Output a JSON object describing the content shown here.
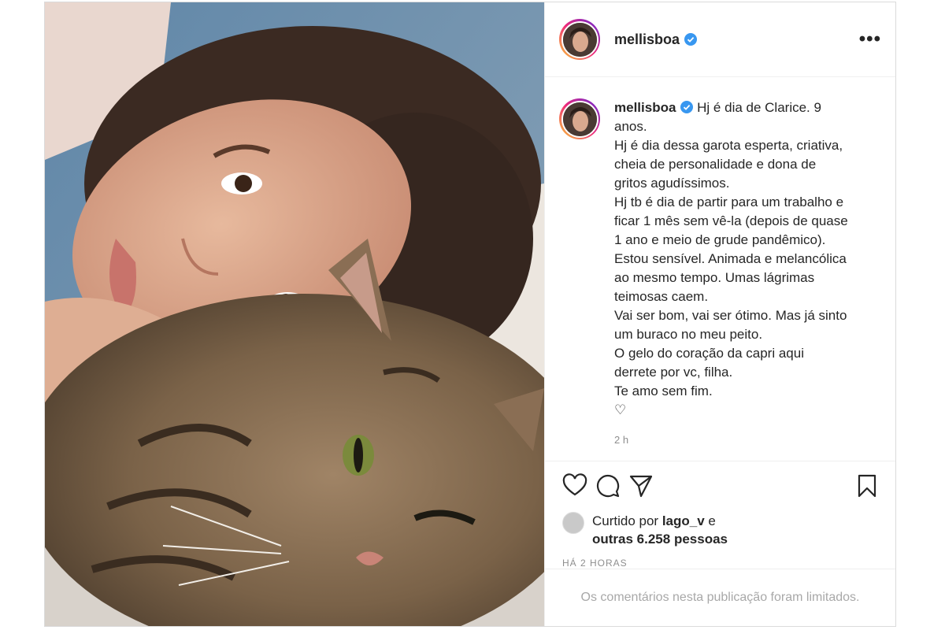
{
  "post": {
    "username": "mellisboa",
    "more_label": "•••",
    "caption": {
      "username": "mellisboa",
      "text": "Hj é dia de Clarice. 9\nanos.\nHj é dia dessa garota esperta, criativa,\ncheia de personalidade e dona de\ngritos agudíssimos.\nHj tb é dia de partir para um trabalho e\nficar 1 mês sem vê-la (depois de quase\n1 ano e meio de grude pandêmico).\nEstou sensível. Animada e melancólica\nao mesmo tempo. Umas lágrimas\nteimosas caem.\nVai ser bom, vai ser ótimo. Mas já sinto\num buraco no meu peito.\nO gelo do coração da capri aqui\nderrete por vc, filha.\nTe amo sem fim.\n♡"
    },
    "comment_time": "2 h",
    "likes": {
      "prefix": "Curtido por ",
      "user": "lago_v",
      "middle": " e",
      "others": "outras 6.258 pessoas"
    },
    "posted_ago": "HÁ 2 HORAS",
    "comments_limited": "Os comentários nesta publicação foram limitados."
  },
  "icons": {
    "like": "heart-icon",
    "comment": "comment-icon",
    "share": "paper-plane-icon",
    "save": "bookmark-icon",
    "verified": "verified-badge-icon"
  },
  "colors": {
    "verified": "#3897f0",
    "border": "#dbdbdb",
    "muted": "#8e8e8e"
  }
}
